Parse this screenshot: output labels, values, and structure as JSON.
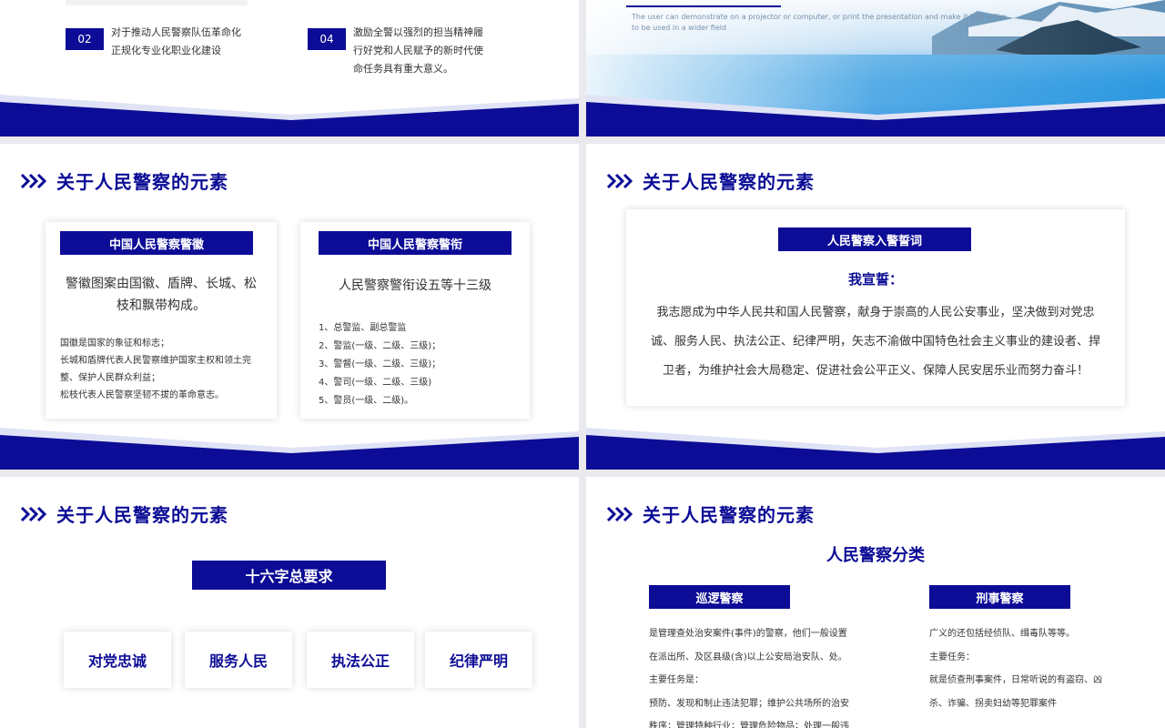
{
  "colors": {
    "navy": "#0c0c96",
    "light": "#dfe3f5",
    "text": "#333333"
  },
  "slide1": {
    "item_02": {
      "num": "02",
      "text": "对于推动人民警察队伍革命化正规化专业化职业化建设"
    },
    "item_04": {
      "num": "04",
      "text": "激励全警以强烈的担当精神履行好党和人民赋予的新时代使命任务具有重大意义。"
    }
  },
  "slide2": {
    "caption": "The user can demonstrate on a projector or computer, or print the presentation and make it into a film to be used in a wider field"
  },
  "slide3": {
    "heading": "关于人民警察的元素",
    "card1": {
      "label": "中国人民警察警徽",
      "main": "警徽图案由国徽、盾牌、长城、松枝和飘带构成。",
      "lines": [
        "国徽是国家的象征和标志；",
        "长城和盾牌代表人民警察维护国家主权和领土完整、保护人民群众利益；",
        "松枝代表人民警察坚韧不拔的革命意志。"
      ]
    },
    "card2": {
      "label": "中国人民警察警衔",
      "main": "人民警察警衔设五等十三级",
      "lines": [
        "1、总警监、副总警监",
        "2、警监(一级、二级、三级)；",
        "3、警督(一级、二级、三级)；",
        "4、警司(一级、二级、三级)",
        "5、警员(一级、二级)。"
      ]
    }
  },
  "slide4": {
    "heading": "关于人民警察的元素",
    "label": "人民警察入警誓词",
    "oath_title": "我宣誓：",
    "oath_text": "我志愿成为中华人民共和国人民警察，献身于崇高的人民公安事业，坚决做到对党忠诚、服务人民、执法公正、纪律严明，矢志不渝做中国特色社会主义事业的建设者、捍卫者，为维护社会大局稳定、促进社会公平正义、保障人民安居乐业而努力奋斗！"
  },
  "slide5": {
    "heading": "关于人民警察的元素",
    "title": "十六字总要求",
    "items": [
      "对党忠诚",
      "服务人民",
      "执法公正",
      "纪律严明"
    ]
  },
  "slide6": {
    "heading": "关于人民警察的元素",
    "title": "人民警察分类",
    "col1": {
      "label": "巡逻警察",
      "lines": [
        "是管理查处治安案件(事件)的警察，他们一般设置",
        "在派出所、及区县级(含)以上公安局治安队、处。",
        "主要任务是：",
        "预防、发现和制止违法犯罪；维护公共场所的治安",
        "秩序；管理特种行业；管理危险物品；处理一般违"
      ]
    },
    "col2": {
      "label": "刑事警察",
      "lines": [
        "广义的还包括经侦队、缉毒队等等。",
        "主要任务：",
        "就是侦查刑事案件，日常听说的有盗窃、凶",
        "杀、诈骗、拐卖妇幼等犯罪案件"
      ]
    }
  }
}
